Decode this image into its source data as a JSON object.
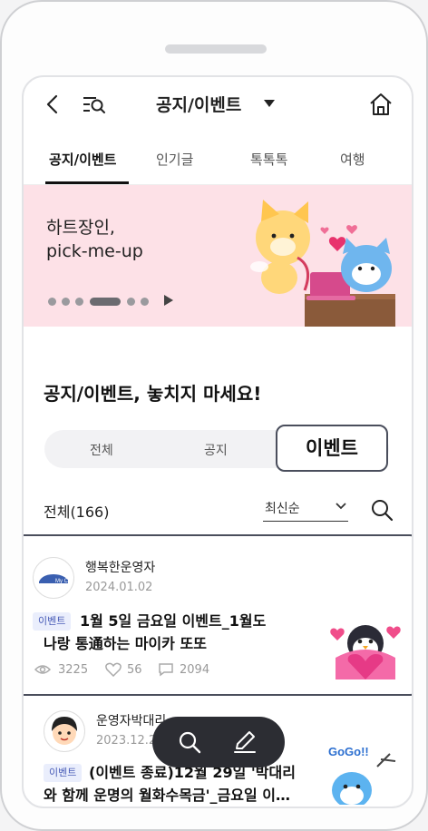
{
  "header": {
    "title": "공지/이벤트"
  },
  "tabs": [
    "공지/이벤트",
    "인기글",
    "톡톡톡",
    "여행"
  ],
  "banner": {
    "line1": "하트장인,",
    "line2": "pick-me-up"
  },
  "section_title": "공지/이벤트, 놓치지 마세요!",
  "segments": {
    "all": "전체",
    "notice": "공지",
    "event": "이벤트"
  },
  "list": {
    "count_label": "전체(166)",
    "sort_label": "최신순"
  },
  "posts": [
    {
      "author": "행복한운영자",
      "date": "2024.01.02",
      "badge": "이벤트",
      "title_line1": "1월 5일 금요일 이벤트_1월도",
      "title_line2": "나랑 통通하는 마이카 또또",
      "views": "3225",
      "likes": "56",
      "comments": "2094",
      "avatar_text": "My Car"
    },
    {
      "author": "운영자박대리",
      "date": "2023.12.2",
      "badge": "이벤트",
      "title_line1": "(이벤트 종료)12월 29일 '박대리",
      "title_line2": "와 함께 운명의 월화수목금'_금요일 이…",
      "thumb_text": "GoGo!!"
    }
  ],
  "colors": {
    "accent": "#4a5db8",
    "banner_bg": "#fde1e7",
    "float_bg": "#2c2d33"
  }
}
